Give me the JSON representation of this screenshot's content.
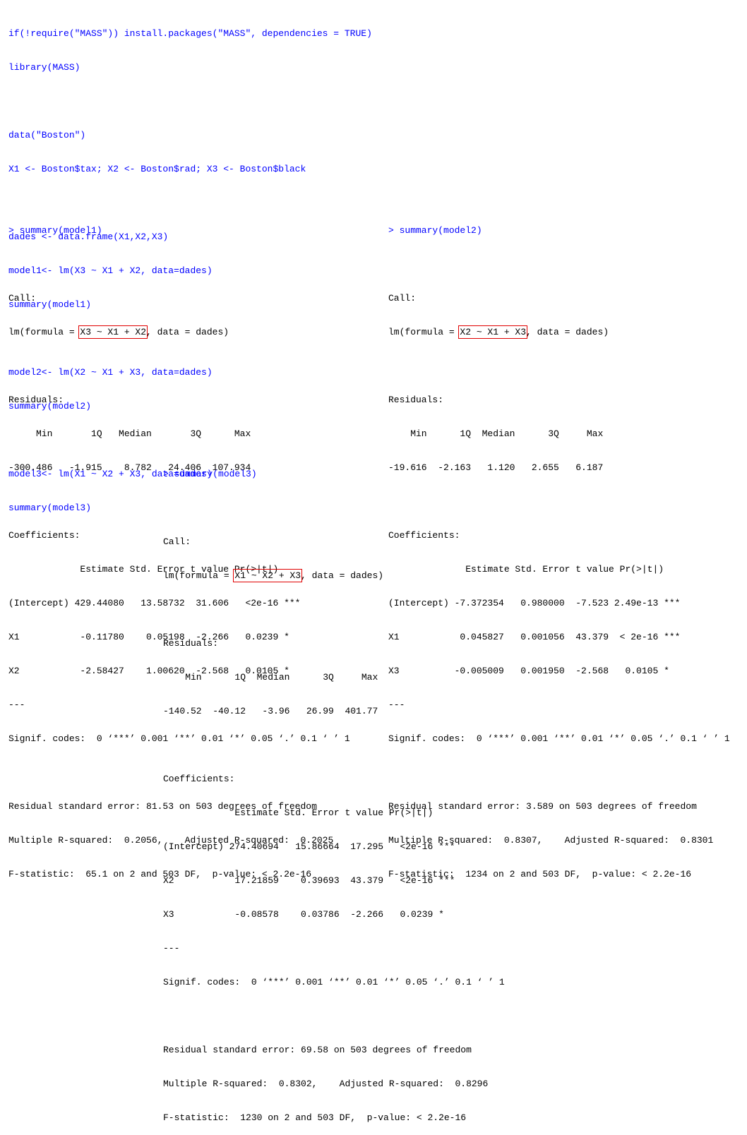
{
  "code": [
    "if(!require(\"MASS\")) install.packages(\"MASS\", dependencies = TRUE)",
    "library(MASS)",
    "",
    "data(\"Boston\")",
    "X1 <- Boston$tax; X2 <- Boston$rad; X3 <- Boston$black",
    "",
    "dades <- data.frame(X1,X2,X3)",
    "model1<- lm(X3 ~ X1 + X2, data=dades)",
    "summary(model1)",
    "",
    "model2<- lm(X2 ~ X1 + X3, data=dades)",
    "summary(model2)",
    "",
    "model3<- lm(X1 ~ X2 + X3, data=dades)",
    "summary(model3)"
  ],
  "models": {
    "model1": {
      "prompt": "> summary(model1)",
      "call_label": "Call:",
      "call_prefix": "lm(formula = ",
      "formula": "X3 ~ X1 + X2",
      "call_suffix": ", data = dades)",
      "residuals_label": "Residuals:",
      "residuals_header": "     Min       1Q   Median       3Q      Max",
      "residuals_values": "-300.486   -1.915    8.782   24.406  107.934",
      "coef_label": "Coefficients:",
      "coef_header": "             Estimate Std. Error t value Pr(>|t|)",
      "coef_rows": [
        "(Intercept) 429.44080   13.58732  31.606   <2e-16 ***",
        "X1           -0.11780    0.05198  -2.266   0.0239 *",
        "X2           -2.58427    1.00620  -2.568   0.0105 *"
      ],
      "sep": "---",
      "signif": "Signif. codes:  0 ‘***’ 0.001 ‘**’ 0.01 ‘*’ 0.05 ‘.’ 0.1 ‘ ’ 1",
      "rse": "Residual standard error: 81.53 on 503 degrees of freedom",
      "rsq": "Multiple R-squared:  0.2056,\tAdjusted R-squared:  0.2025",
      "fstat": "F-statistic:  65.1 on 2 and 503 DF,  p-value: < 2.2e-16"
    },
    "model2": {
      "prompt": "> summary(model2)",
      "call_label": "Call:",
      "call_prefix": "lm(formula = ",
      "formula": "X2 ~ X1 + X3",
      "call_suffix": ", data = dades)",
      "residuals_label": "Residuals:",
      "residuals_header": "    Min      1Q  Median      3Q     Max",
      "residuals_values": "-19.616  -2.163   1.120   2.655   6.187",
      "coef_label": "Coefficients:",
      "coef_header": "              Estimate Std. Error t value Pr(>|t|)",
      "coef_rows": [
        "(Intercept) -7.372354   0.980000  -7.523 2.49e-13 ***",
        "X1           0.045827   0.001056  43.379  < 2e-16 ***",
        "X3          -0.005009   0.001950  -2.568   0.0105 *"
      ],
      "sep": "---",
      "signif": "Signif. codes:  0 ‘***’ 0.001 ‘**’ 0.01 ‘*’ 0.05 ‘.’ 0.1 ‘ ’ 1",
      "rse": "Residual standard error: 3.589 on 503 degrees of freedom",
      "rsq": "Multiple R-squared:  0.8307,\tAdjusted R-squared:  0.8301",
      "fstat": "F-statistic:  1234 on 2 and 503 DF,  p-value: < 2.2e-16"
    },
    "model3": {
      "prompt": "> summary(model3)",
      "call_label": "Call:",
      "call_prefix": "lm(formula = ",
      "formula": "X1 ~ X2 + X3",
      "call_suffix": ", data = dades)",
      "residuals_label": "Residuals:",
      "residuals_header": "    Min      1Q  Median      3Q     Max",
      "residuals_values": "-140.52  -40.12   -3.96   26.99  401.77",
      "coef_label": "Coefficients:",
      "coef_header": "             Estimate Std. Error t value Pr(>|t|)",
      "coef_rows": [
        "(Intercept) 274.40694   15.86664  17.295   <2e-16 ***",
        "X2           17.21859    0.39693  43.379   <2e-16 ***",
        "X3           -0.08578    0.03786  -2.266   0.0239 *"
      ],
      "sep": "---",
      "signif": "Signif. codes:  0 ‘***’ 0.001 ‘**’ 0.01 ‘*’ 0.05 ‘.’ 0.1 ‘ ’ 1",
      "rse": "Residual standard error: 69.58 on 503 degrees of freedom",
      "rsq": "Multiple R-squared:  0.8302,\tAdjusted R-squared:  0.8296",
      "fstat": "F-statistic:  1230 on 2 and 503 DF,  p-value: < 2.2e-16"
    }
  },
  "colors": {
    "code_text": "#0000ff",
    "output_text": "#000000",
    "highlight_box": "#e00000"
  }
}
